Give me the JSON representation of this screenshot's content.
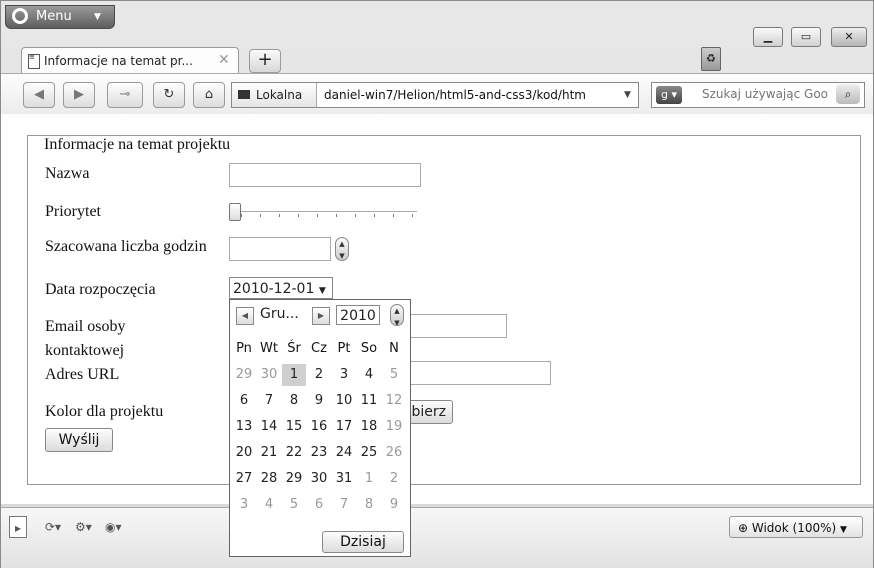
{
  "browser": {
    "menu_label": "Menu",
    "tab_title": "Informacje na temat pr...",
    "address_badge": "Lokalna",
    "url": "daniel-win7/Helion/html5-and-css3/kod/htm",
    "search_placeholder": "Szukaj używając Goo",
    "zoom_label": "Widok (100%)"
  },
  "form": {
    "legend": "Informacje na temat projektu",
    "name_label": "Nazwa",
    "priority_label": "Priorytet",
    "hours_label": "Szacowana liczba godzin",
    "start_date_label": "Data rozpoczęcia",
    "start_date_value": "2010-12-01",
    "email_label_line1": "Email osoby",
    "email_label_line2": "kontaktowej",
    "url_label": "Adres URL",
    "color_label": "Kolor dla projektu",
    "color_button_label": "bierz",
    "submit_label": "Wyślij",
    "priority_value": 0.0
  },
  "calendar": {
    "month": "Gru...",
    "year": "2010",
    "weekdays": [
      "Pn",
      "Wt",
      "Śr",
      "Cz",
      "Pt",
      "So",
      "N"
    ],
    "weeks": [
      [
        {
          "d": "29",
          "m": true
        },
        {
          "d": "30",
          "m": true
        },
        {
          "d": "1",
          "s": true
        },
        {
          "d": "2"
        },
        {
          "d": "3"
        },
        {
          "d": "4"
        },
        {
          "d": "5",
          "m": true
        }
      ],
      [
        {
          "d": "6"
        },
        {
          "d": "7"
        },
        {
          "d": "8"
        },
        {
          "d": "9"
        },
        {
          "d": "10"
        },
        {
          "d": "11"
        },
        {
          "d": "12",
          "m": true
        }
      ],
      [
        {
          "d": "13"
        },
        {
          "d": "14"
        },
        {
          "d": "15"
        },
        {
          "d": "16"
        },
        {
          "d": "17"
        },
        {
          "d": "18"
        },
        {
          "d": "19",
          "m": true
        }
      ],
      [
        {
          "d": "20"
        },
        {
          "d": "21"
        },
        {
          "d": "22"
        },
        {
          "d": "23"
        },
        {
          "d": "24"
        },
        {
          "d": "25"
        },
        {
          "d": "26",
          "m": true
        }
      ],
      [
        {
          "d": "27"
        },
        {
          "d": "28"
        },
        {
          "d": "29"
        },
        {
          "d": "30"
        },
        {
          "d": "31"
        },
        {
          "d": "1",
          "m": true
        },
        {
          "d": "2",
          "m": true
        }
      ],
      [
        {
          "d": "3",
          "m": true
        },
        {
          "d": "4",
          "m": true
        },
        {
          "d": "5",
          "m": true
        },
        {
          "d": "6",
          "m": true
        },
        {
          "d": "7",
          "m": true
        },
        {
          "d": "8",
          "m": true
        },
        {
          "d": "9",
          "m": true
        }
      ]
    ],
    "today_label": "Dzisiaj"
  }
}
